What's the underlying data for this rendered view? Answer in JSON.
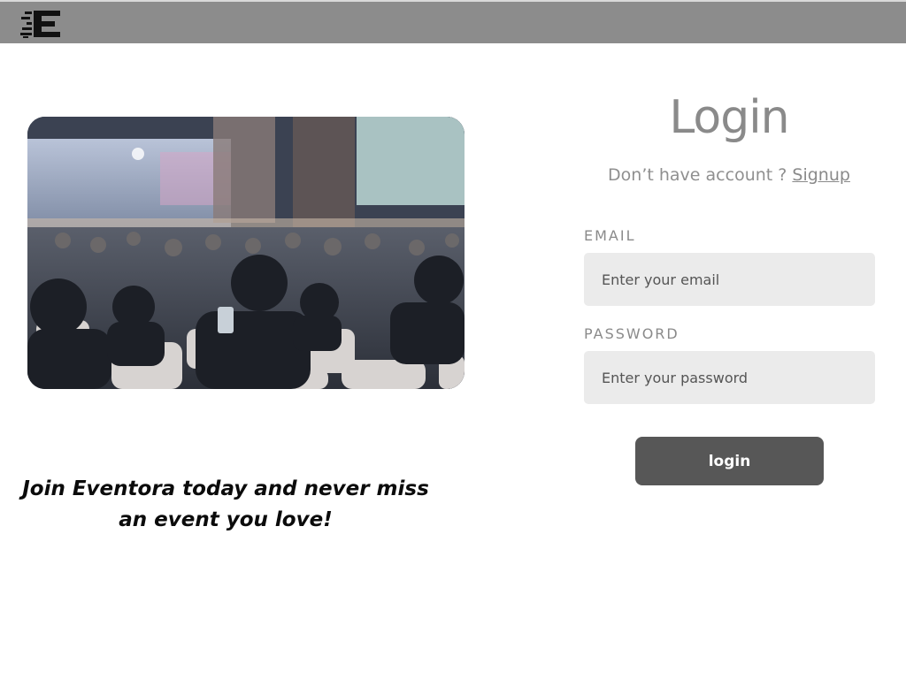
{
  "header": {
    "logo_icon": "eventora-logo-icon"
  },
  "hero": {
    "image": "conference-audience-photo",
    "tagline_line1": "Join Eventora today and never miss",
    "tagline_line2": "an event you love!"
  },
  "login": {
    "title": "Login",
    "signup_prompt": "Don’t have account ?",
    "signup_link": "Signup",
    "email": {
      "label": "EMAIL",
      "placeholder": "Enter your email",
      "value": ""
    },
    "password": {
      "label": "PASSWORD",
      "placeholder": "Enter your password",
      "value": ""
    },
    "submit_label": "login"
  },
  "colors": {
    "topbar": "#8c8c8c",
    "button": "#575757",
    "input_bg": "#ebebeb",
    "muted_text": "#8a8a8a"
  }
}
